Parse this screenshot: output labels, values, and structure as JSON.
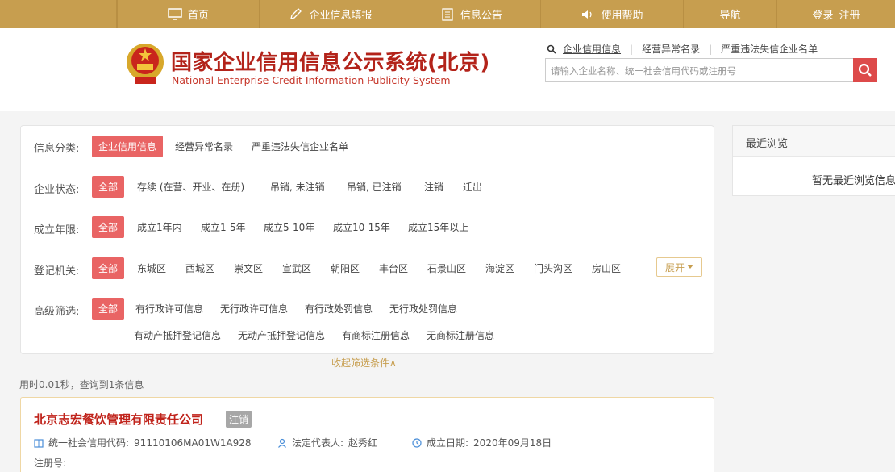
{
  "topnav": {
    "home": "首页",
    "fill": "企业信息填报",
    "notice": "信息公告",
    "help": "使用帮助",
    "guide": "导航",
    "login": "登录",
    "register": "注册"
  },
  "header": {
    "title_cn": "国家企业信用信息公示系统(北京)",
    "title_en": "National Enterprise Credit Information Publicity System",
    "links": [
      "企业信用信息",
      "经营异常名录",
      "严重违法失信企业名单"
    ],
    "search_placeholder": "请输入企业名称、统一社会信用代码或注册号"
  },
  "filter": {
    "category": {
      "label": "信息分类:",
      "options": [
        "企业信用信息",
        "经营异常名录",
        "严重违法失信企业名单"
      ]
    },
    "status": {
      "label": "企业状态:",
      "options": [
        "全部",
        "存续 (在营、开业、在册)",
        "吊销, 未注销",
        "吊销, 已注销",
        "注销",
        "迁出"
      ]
    },
    "age": {
      "label": "成立年限:",
      "options": [
        "全部",
        "成立1年内",
        "成立1-5年",
        "成立5-10年",
        "成立10-15年",
        "成立15年以上"
      ]
    },
    "authority": {
      "label": "登记机关:",
      "options": [
        "全部",
        "东城区",
        "西城区",
        "崇文区",
        "宣武区",
        "朝阳区",
        "丰台区",
        "石景山区",
        "海淀区",
        "门头沟区",
        "房山区"
      ],
      "expand": "展开"
    },
    "advanced": {
      "label": "高级筛选:",
      "options_row1": [
        "全部",
        "有行政许可信息",
        "无行政许可信息",
        "有行政处罚信息",
        "无行政处罚信息"
      ],
      "options_row2": [
        "有动产抵押登记信息",
        "无动产抵押登记信息",
        "有商标注册信息",
        "无商标注册信息"
      ]
    },
    "collapse": "收起筛选条件∧"
  },
  "meta": "用时0.01秒，查询到1条信息",
  "result": {
    "company": "北京志宏餐饮管理有限责任公司",
    "status": "注销",
    "credit_code_label": "统一社会信用代码:",
    "credit_code": "91110106MA01W1A928",
    "rep_label": "法定代表人:",
    "rep": "赵秀红",
    "date_label": "成立日期:",
    "date": "2020年09月18日",
    "reg_label": "注册号:"
  },
  "recent": {
    "title": "最近浏览",
    "empty": "暂无最近浏览信息"
  },
  "colors": {
    "nav": "#c79e4f",
    "brand_red": "#b3231a",
    "highlight": "#e96464"
  }
}
